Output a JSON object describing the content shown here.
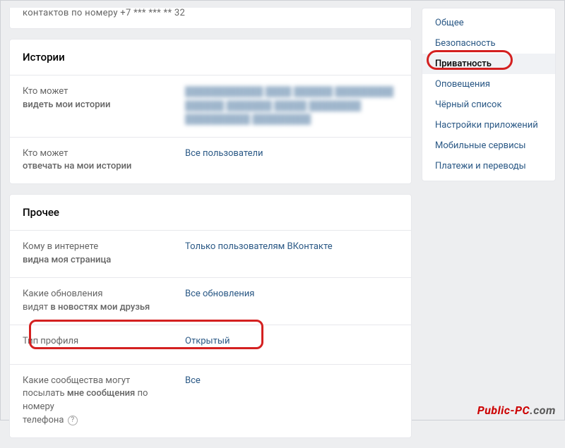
{
  "top_partial": {
    "label_prefix": "контактов по номеру +7",
    "masked": " *** *** **",
    "suffix": " 32"
  },
  "sections": [
    {
      "title": "Истории",
      "rows": [
        {
          "label_line1": "Кто может",
          "label_line2_bold": "видеть мои истории",
          "value": "████████████ ████ ██████\n█████████ ██████ ███████ █████\n████████ ██████████ █████████",
          "blurred": true
        },
        {
          "label_line1": "Кто может",
          "label_line2_bold": "отвечать на мои истории",
          "value": "Все пользователи",
          "blurred": false
        }
      ]
    },
    {
      "title": "Прочее",
      "rows": [
        {
          "label_line1": "Кому в интернете",
          "label_line2_bold": "видна моя страница",
          "value": "Только пользователям ВКонтакте",
          "blurred": false
        },
        {
          "label_line1": "Какие обновления",
          "label_line2_part1": "видят ",
          "label_line2_bold": "в новостях мои друзья",
          "value": "Все обновления",
          "blurred": false
        },
        {
          "label_line1": "Тип профиля",
          "value": "Открытый",
          "blurred": false,
          "highlight": true
        },
        {
          "label_line1": "Какие сообщества могут",
          "label_line2_part1": "посылать ",
          "label_line2_bold": "мне сообщения",
          "label_line2_part2": " по номеру",
          "label_line3": "телефона",
          "help": true,
          "value": "Все",
          "blurred": false
        }
      ]
    }
  ],
  "sidebar": {
    "items": [
      {
        "label": "Общее"
      },
      {
        "label": "Безопасность"
      },
      {
        "label": "Приватность",
        "selected": true,
        "highlight": true
      },
      {
        "label": "Оповещения"
      },
      {
        "label": "Чёрный список"
      },
      {
        "label": "Настройки приложений"
      },
      {
        "label": "Мобильные сервисы"
      },
      {
        "label": "Платежи и переводы"
      }
    ]
  },
  "watermark": {
    "red": "Public-PC",
    "gray": ".com"
  },
  "help_char": "?"
}
